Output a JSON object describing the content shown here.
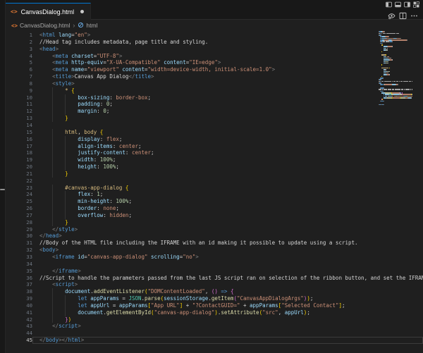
{
  "colors": {
    "accent_blue": "#0078d4",
    "editor_bg": "#1f1f1f",
    "chrome_bg": "#181818",
    "tag": "#569cd6",
    "attr_name": "#9cdcfe",
    "string": "#ce9178",
    "plain_text": "#d4d4d4",
    "css_selector": "#d7ba7d",
    "number": "#b5cea8",
    "bracket_level1": "#ffd700",
    "bracket_level2": "#da70d6",
    "function": "#dcdcaa",
    "keyword": "#569cd6",
    "support_class": "#4ec9b0",
    "punctuation": "#808080",
    "line_number": "#6e7681",
    "html_file_icon": "#e37933"
  },
  "tab": {
    "label": "CanvasDialog.html",
    "modified": true,
    "file_icon": "html-angle-brackets"
  },
  "title_bar_icons": [
    "layout-sidebar-left-icon",
    "layout-panel-icon",
    "layout-sidebar-right-icon",
    "customize-layout-icon"
  ],
  "editor_action_icons": [
    "open-preview-icon",
    "split-editor-icon",
    "more-actions-icon"
  ],
  "breadcrumb": {
    "file": "CanvasDialog.html",
    "separator": "›",
    "symbol": "html",
    "symbol_icon": "html-element-symbol-icon"
  },
  "editor": {
    "active_line": 45,
    "lines": [
      {
        "n": 1,
        "s": [
          [
            "p",
            "<"
          ],
          [
            "g",
            "html"
          ],
          [
            "w",
            " "
          ],
          [
            "a",
            "lang"
          ],
          [
            "o",
            "="
          ],
          [
            "s",
            "\"en\""
          ],
          [
            "p",
            ">"
          ]
        ]
      },
      {
        "n": 2,
        "s": [
          [
            "w",
            "//Head tag includes metadata, page title and styling."
          ]
        ]
      },
      {
        "n": 3,
        "s": [
          [
            "p",
            "<"
          ],
          [
            "g",
            "head"
          ],
          [
            "p",
            ">"
          ]
        ]
      },
      {
        "n": 4,
        "s": [
          [
            "w",
            "    "
          ],
          [
            "p",
            "<"
          ],
          [
            "g",
            "meta"
          ],
          [
            "w",
            " "
          ],
          [
            "a",
            "charset"
          ],
          [
            "o",
            "="
          ],
          [
            "s",
            "\"UTF-8\""
          ],
          [
            "p",
            ">"
          ]
        ]
      },
      {
        "n": 5,
        "s": [
          [
            "w",
            "    "
          ],
          [
            "p",
            "<"
          ],
          [
            "g",
            "meta"
          ],
          [
            "w",
            " "
          ],
          [
            "a",
            "http-equiv"
          ],
          [
            "o",
            "="
          ],
          [
            "s",
            "\"X-UA-Compatible\""
          ],
          [
            "w",
            " "
          ],
          [
            "a",
            "content"
          ],
          [
            "o",
            "="
          ],
          [
            "s",
            "\"IE=edge\""
          ],
          [
            "p",
            ">"
          ]
        ]
      },
      {
        "n": 6,
        "s": [
          [
            "w",
            "    "
          ],
          [
            "p",
            "<"
          ],
          [
            "g",
            "meta"
          ],
          [
            "w",
            " "
          ],
          [
            "a",
            "name"
          ],
          [
            "o",
            "="
          ],
          [
            "s",
            "\"viewport\""
          ],
          [
            "w",
            " "
          ],
          [
            "a",
            "content"
          ],
          [
            "o",
            "="
          ],
          [
            "s",
            "\"width=device-width, initial-scale=1.0\""
          ],
          [
            "p",
            ">"
          ]
        ]
      },
      {
        "n": 7,
        "s": [
          [
            "w",
            "    "
          ],
          [
            "p",
            "<"
          ],
          [
            "g",
            "title"
          ],
          [
            "p",
            ">"
          ],
          [
            "w",
            "Canvas App Dialog"
          ],
          [
            "p",
            "</"
          ],
          [
            "g",
            "title"
          ],
          [
            "p",
            ">"
          ]
        ]
      },
      {
        "n": 8,
        "s": [
          [
            "w",
            "    "
          ],
          [
            "p",
            "<"
          ],
          [
            "g",
            "style"
          ],
          [
            "p",
            ">"
          ]
        ]
      },
      {
        "n": 9,
        "s": [
          [
            "w",
            "        "
          ],
          [
            "sel",
            "*"
          ],
          [
            "w",
            " "
          ],
          [
            "b1",
            "{"
          ]
        ]
      },
      {
        "n": 10,
        "s": [
          [
            "w",
            "            "
          ],
          [
            "prop",
            "box-sizing"
          ],
          [
            "o",
            ": "
          ],
          [
            "val",
            "border-box"
          ],
          [
            "o",
            ";"
          ]
        ]
      },
      {
        "n": 11,
        "s": [
          [
            "w",
            "            "
          ],
          [
            "prop",
            "padding"
          ],
          [
            "o",
            ": "
          ],
          [
            "num",
            "0"
          ],
          [
            "o",
            ";"
          ]
        ]
      },
      {
        "n": 12,
        "s": [
          [
            "w",
            "            "
          ],
          [
            "prop",
            "margin"
          ],
          [
            "o",
            ": "
          ],
          [
            "num",
            "0"
          ],
          [
            "o",
            ";"
          ]
        ]
      },
      {
        "n": 13,
        "s": [
          [
            "w",
            "        "
          ],
          [
            "b1",
            "}"
          ]
        ]
      },
      {
        "n": 14,
        "s": []
      },
      {
        "n": 15,
        "s": [
          [
            "w",
            "        "
          ],
          [
            "sel",
            "html"
          ],
          [
            "o",
            ", "
          ],
          [
            "sel",
            "body"
          ],
          [
            "w",
            " "
          ],
          [
            "b1",
            "{"
          ]
        ]
      },
      {
        "n": 16,
        "s": [
          [
            "w",
            "            "
          ],
          [
            "prop",
            "display"
          ],
          [
            "o",
            ": "
          ],
          [
            "val",
            "flex"
          ],
          [
            "o",
            ";"
          ]
        ]
      },
      {
        "n": 17,
        "s": [
          [
            "w",
            "            "
          ],
          [
            "prop",
            "align-items"
          ],
          [
            "o",
            ": "
          ],
          [
            "val",
            "center"
          ],
          [
            "o",
            ";"
          ]
        ]
      },
      {
        "n": 18,
        "s": [
          [
            "w",
            "            "
          ],
          [
            "prop",
            "justify-content"
          ],
          [
            "o",
            ": "
          ],
          [
            "val",
            "center"
          ],
          [
            "o",
            ";"
          ]
        ]
      },
      {
        "n": 19,
        "s": [
          [
            "w",
            "            "
          ],
          [
            "prop",
            "width"
          ],
          [
            "o",
            ": "
          ],
          [
            "num",
            "100%"
          ],
          [
            "o",
            ";"
          ]
        ]
      },
      {
        "n": 20,
        "s": [
          [
            "w",
            "            "
          ],
          [
            "prop",
            "height"
          ],
          [
            "o",
            ": "
          ],
          [
            "num",
            "100%"
          ],
          [
            "o",
            ";"
          ]
        ]
      },
      {
        "n": 21,
        "s": [
          [
            "w",
            "        "
          ],
          [
            "b1",
            "}"
          ]
        ]
      },
      {
        "n": 22,
        "s": []
      },
      {
        "n": 23,
        "s": [
          [
            "w",
            "        "
          ],
          [
            "sel",
            "#canvas-app-dialog"
          ],
          [
            "w",
            " "
          ],
          [
            "b1",
            "{"
          ]
        ]
      },
      {
        "n": 24,
        "s": [
          [
            "w",
            "            "
          ],
          [
            "prop",
            "flex"
          ],
          [
            "o",
            ": "
          ],
          [
            "num",
            "1"
          ],
          [
            "o",
            ";"
          ]
        ]
      },
      {
        "n": 25,
        "s": [
          [
            "w",
            "            "
          ],
          [
            "prop",
            "min-height"
          ],
          [
            "o",
            ": "
          ],
          [
            "num",
            "100%"
          ],
          [
            "o",
            ";"
          ]
        ]
      },
      {
        "n": 26,
        "s": [
          [
            "w",
            "            "
          ],
          [
            "prop",
            "border"
          ],
          [
            "o",
            ": "
          ],
          [
            "val",
            "none"
          ],
          [
            "o",
            ";"
          ]
        ]
      },
      {
        "n": 27,
        "s": [
          [
            "w",
            "            "
          ],
          [
            "prop",
            "overflow"
          ],
          [
            "o",
            ": "
          ],
          [
            "val",
            "hidden"
          ],
          [
            "o",
            ";"
          ]
        ]
      },
      {
        "n": 28,
        "s": [
          [
            "w",
            "        "
          ],
          [
            "b1",
            "}"
          ]
        ]
      },
      {
        "n": 29,
        "s": [
          [
            "w",
            "    "
          ],
          [
            "p",
            "</"
          ],
          [
            "g",
            "style"
          ],
          [
            "p",
            ">"
          ]
        ]
      },
      {
        "n": 30,
        "s": [
          [
            "p",
            "</"
          ],
          [
            "g",
            "head"
          ],
          [
            "p",
            ">"
          ]
        ]
      },
      {
        "n": 31,
        "s": [
          [
            "w",
            "//Body of the HTML file including the IFRAME with an id making it possible to update using a script."
          ]
        ]
      },
      {
        "n": 32,
        "s": [
          [
            "p",
            "<"
          ],
          [
            "g",
            "body"
          ],
          [
            "p",
            ">"
          ]
        ]
      },
      {
        "n": 33,
        "s": [
          [
            "w",
            "    "
          ],
          [
            "p",
            "<"
          ],
          [
            "g",
            "iframe"
          ],
          [
            "w",
            " "
          ],
          [
            "a",
            "id"
          ],
          [
            "o",
            "="
          ],
          [
            "s",
            "\"canvas-app-dialog\""
          ],
          [
            "w",
            " "
          ],
          [
            "a",
            "scrolling"
          ],
          [
            "o",
            "="
          ],
          [
            "s",
            "\"no\""
          ],
          [
            "p",
            ">"
          ]
        ]
      },
      {
        "n": 34,
        "s": []
      },
      {
        "n": 35,
        "s": [
          [
            "w",
            "    "
          ],
          [
            "p",
            "</"
          ],
          [
            "g",
            "iframe"
          ],
          [
            "p",
            ">"
          ]
        ]
      },
      {
        "n": 36,
        "s": [
          [
            "w",
            "//Script to handle the parameters passed from the last JS script ran on selection of the ribbon button, and set the IFRAME w"
          ]
        ]
      },
      {
        "n": 37,
        "s": [
          [
            "w",
            "    "
          ],
          [
            "p",
            "<"
          ],
          [
            "g",
            "script"
          ],
          [
            "p",
            ">"
          ]
        ]
      },
      {
        "n": 38,
        "s": [
          [
            "w",
            "        "
          ],
          [
            "v",
            "document"
          ],
          [
            "o",
            "."
          ],
          [
            "fn",
            "addEventListener"
          ],
          [
            "b1",
            "("
          ],
          [
            "s",
            "\"DOMContentLoaded\""
          ],
          [
            "o",
            ", "
          ],
          [
            "b2",
            "()"
          ],
          [
            "w",
            " "
          ],
          [
            "kw",
            "=>"
          ],
          [
            "w",
            " "
          ],
          [
            "b2",
            "{"
          ]
        ]
      },
      {
        "n": 39,
        "s": [
          [
            "w",
            "            "
          ],
          [
            "kw",
            "let"
          ],
          [
            "w",
            " "
          ],
          [
            "v",
            "appParams"
          ],
          [
            "o",
            " = "
          ],
          [
            "cls",
            "JSON"
          ],
          [
            "o",
            "."
          ],
          [
            "fn",
            "parse"
          ],
          [
            "b1",
            "("
          ],
          [
            "v",
            "sessionStorage"
          ],
          [
            "o",
            "."
          ],
          [
            "fn",
            "getItem"
          ],
          [
            "b2",
            "("
          ],
          [
            "s",
            "\"CanvasAppDialogArgs\""
          ],
          [
            "b2",
            ")"
          ],
          [
            "b1",
            ")"
          ],
          [
            "o",
            ";"
          ]
        ]
      },
      {
        "n": 40,
        "s": [
          [
            "w",
            "            "
          ],
          [
            "kw",
            "let"
          ],
          [
            "w",
            " "
          ],
          [
            "v",
            "appUrl"
          ],
          [
            "o",
            " = "
          ],
          [
            "v",
            "appParams"
          ],
          [
            "b1",
            "["
          ],
          [
            "s",
            "\"App URL\""
          ],
          [
            "b1",
            "]"
          ],
          [
            "o",
            " + "
          ],
          [
            "s",
            "\"?ContactGUID=\""
          ],
          [
            "o",
            " + "
          ],
          [
            "v",
            "appParams"
          ],
          [
            "b1",
            "["
          ],
          [
            "s",
            "\"Selected Contact\""
          ],
          [
            "b1",
            "]"
          ],
          [
            "o",
            ";"
          ]
        ]
      },
      {
        "n": 41,
        "s": [
          [
            "w",
            "            "
          ],
          [
            "v",
            "document"
          ],
          [
            "o",
            "."
          ],
          [
            "fn",
            "getElementById"
          ],
          [
            "b1",
            "("
          ],
          [
            "s",
            "\"canvas-app-dialog\""
          ],
          [
            "b1",
            ")"
          ],
          [
            "o",
            "."
          ],
          [
            "fn",
            "setAttribute"
          ],
          [
            "b1",
            "("
          ],
          [
            "s",
            "\"src\""
          ],
          [
            "o",
            ", "
          ],
          [
            "v",
            "appUrl"
          ],
          [
            "b1",
            ")"
          ],
          [
            "o",
            ";"
          ]
        ]
      },
      {
        "n": 42,
        "s": [
          [
            "w",
            "        "
          ],
          [
            "b2",
            "}"
          ],
          [
            "b1",
            ")"
          ]
        ]
      },
      {
        "n": 43,
        "s": [
          [
            "w",
            "    "
          ],
          [
            "p",
            "</"
          ],
          [
            "g",
            "script"
          ],
          [
            "p",
            ">"
          ]
        ]
      },
      {
        "n": 44,
        "s": []
      },
      {
        "n": 45,
        "s": [
          [
            "p",
            "</"
          ],
          [
            "g",
            "body"
          ],
          [
            "p",
            "></"
          ],
          [
            "g",
            "html"
          ],
          [
            "p",
            ">"
          ]
        ]
      }
    ]
  }
}
